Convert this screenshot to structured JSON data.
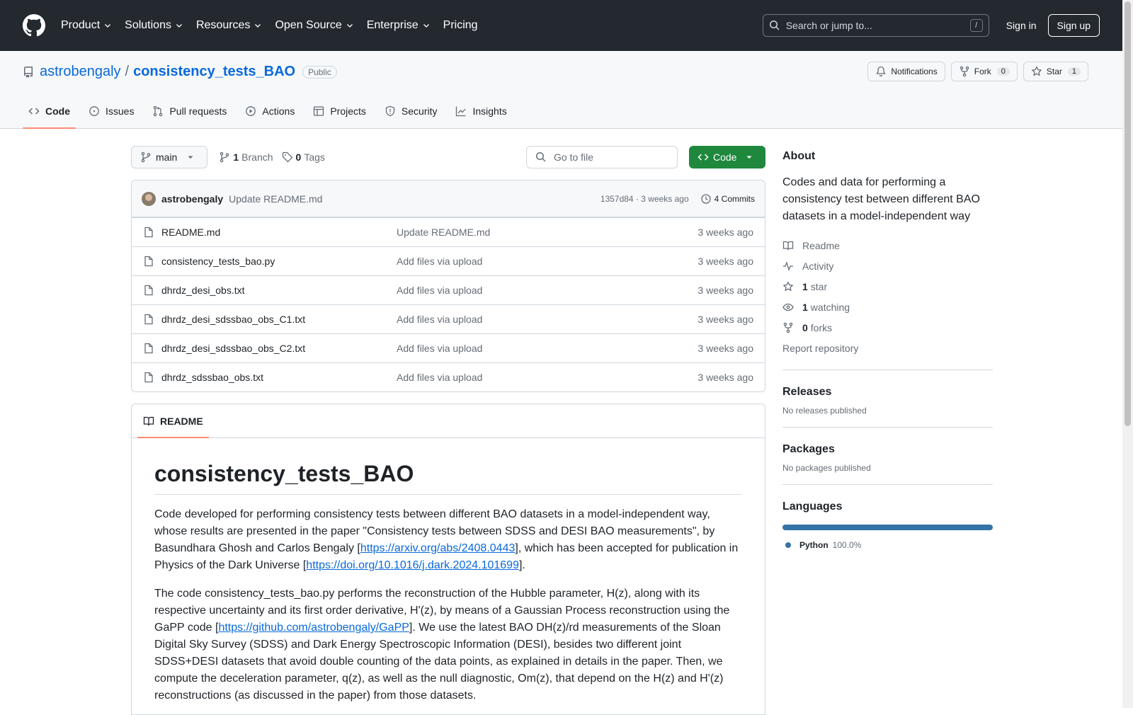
{
  "colors": {
    "header_bg": "#24292f",
    "accent": "#0969da",
    "code_btn": "#1f883d",
    "tab_underline": "#fd8c73",
    "python": "#3572a5"
  },
  "header": {
    "nav": [
      "Product",
      "Solutions",
      "Resources",
      "Open Source",
      "Enterprise",
      "Pricing"
    ],
    "search_placeholder": "Search or jump to...",
    "search_shortcut": "/",
    "sign_in": "Sign in",
    "sign_up": "Sign up"
  },
  "repo": {
    "owner": "astrobengaly",
    "separator": "/",
    "name": "consistency_tests_BAO",
    "visibility": "Public",
    "actions": {
      "notifications": "Notifications",
      "fork": "Fork",
      "fork_count": "0",
      "star": "Star",
      "star_count": "1"
    },
    "tabs": [
      "Code",
      "Issues",
      "Pull requests",
      "Actions",
      "Projects",
      "Security",
      "Insights"
    ]
  },
  "toolbar": {
    "branch": "main",
    "branch_count": "1",
    "branch_label": "Branch",
    "tag_count": "0",
    "tag_label": "Tags",
    "goto_placeholder": "Go to file",
    "code_button": "Code"
  },
  "commit": {
    "author": "astrobengaly",
    "message": "Update README.md",
    "hash_time": "1357d84 · 3 weeks ago",
    "commits": "4 Commits"
  },
  "files": [
    {
      "name": "README.md",
      "message": "Update README.md",
      "time": "3 weeks ago"
    },
    {
      "name": "consistency_tests_bao.py",
      "message": "Add files via upload",
      "time": "3 weeks ago"
    },
    {
      "name": "dhrdz_desi_obs.txt",
      "message": "Add files via upload",
      "time": "3 weeks ago"
    },
    {
      "name": "dhrdz_desi_sdssbao_obs_C1.txt",
      "message": "Add files via upload",
      "time": "3 weeks ago"
    },
    {
      "name": "dhrdz_desi_sdssbao_obs_C2.txt",
      "message": "Add files via upload",
      "time": "3 weeks ago"
    },
    {
      "name": "dhrdz_sdssbao_obs.txt",
      "message": "Add files via upload",
      "time": "3 weeks ago"
    }
  ],
  "readme": {
    "tab": "README",
    "title": "consistency_tests_BAO",
    "p1_a": "Code developed for performing consistency tests between different BAO datasets in a model-independent way, whose results are presented in the paper \"Consistency tests between SDSS and DESI BAO measurements\", by Basundhara Ghosh and Carlos Bengaly [",
    "p1_link1": "https://arxiv.org/abs/2408.0443",
    "p1_b": "], which has been accepted for publication in Physics of the Dark Universe [",
    "p1_link2": "https://doi.org/10.1016/j.dark.2024.101699",
    "p1_c": "].",
    "p2_a": "The code consistency_tests_bao.py performs the reconstruction of the Hubble parameter, H(z), along with its respective uncertainty and its first order derivative, H'(z), by means of a Gaussian Process reconstruction using the GaPP code [",
    "p2_link": "https://github.com/astrobengaly/GaPP",
    "p2_b": "]. We use the latest BAO DH(z)/rd measurements of the Sloan Digital Sky Survey (SDSS) and Dark Energy Spectroscopic Information (DESI), besides two different joint SDSS+DESI datasets that avoid double counting of the data points, as explained in details in the paper. Then, we compute the deceleration parameter, q(z), as well as the null diagnostic, Om(z), that depend on the H(z) and H'(z) reconstructions (as discussed in the paper) from those datasets."
  },
  "sidebar": {
    "about_title": "About",
    "about_desc": "Codes and data for performing a consistency test between different BAO datasets in a model-independent way",
    "readme": "Readme",
    "activity": "Activity",
    "stars_count": "1",
    "stars_label": "star",
    "watching_count": "1",
    "watching_label": "watching",
    "forks_count": "0",
    "forks_label": "forks",
    "report": "Report repository",
    "releases_title": "Releases",
    "releases_empty": "No releases published",
    "packages_title": "Packages",
    "packages_empty": "No packages published",
    "languages_title": "Languages",
    "language_name": "Python",
    "language_pct": "100.0%",
    "language_fraction": 1.0
  }
}
